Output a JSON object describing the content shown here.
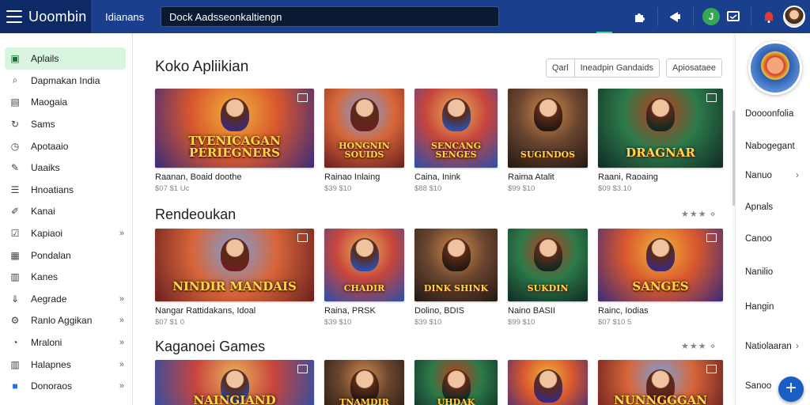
{
  "header": {
    "brand": "Uoombin",
    "label": "Idianans",
    "search_value": "Dock Aadsseonkaltiengn"
  },
  "sidebar": {
    "items": [
      {
        "label": "Aplails",
        "icon": "apps-icon",
        "active": true
      },
      {
        "label": "Dapmakan India",
        "icon": "search-icon"
      },
      {
        "label": "Maogaia",
        "icon": "briefcase-icon"
      },
      {
        "label": "Sams",
        "icon": "refresh-icon"
      },
      {
        "label": "Apotaaio",
        "icon": "clock-icon"
      },
      {
        "label": "Uaaiks",
        "icon": "pencil-icon"
      },
      {
        "label": "Hnoatians",
        "icon": "list-icon"
      },
      {
        "label": "Kanai",
        "icon": "edit-icon"
      },
      {
        "label": "Kapiaoi",
        "icon": "checkbox-icon",
        "chevron": "»"
      },
      {
        "label": "Pondalan",
        "icon": "grid-icon"
      },
      {
        "label": "Kanes",
        "icon": "table-icon"
      },
      {
        "label": "Aegrade",
        "icon": "download-icon",
        "chevron": "»"
      },
      {
        "label": "Ranlo Aggikan",
        "icon": "settings-icon",
        "chevron": "»"
      },
      {
        "label": "Mraloni",
        "icon": "gauge-icon",
        "chevron": "»"
      },
      {
        "label": "Halapnes",
        "icon": "table-icon",
        "chevron": "»"
      },
      {
        "label": "Donoraos",
        "icon": "blue-app-icon",
        "chevron": "»"
      }
    ]
  },
  "main": {
    "section1": {
      "title": "Koko Apliikian",
      "filters": [
        "Qarl",
        "Ineadpin Gandaids",
        "Apiosataee"
      ],
      "cards": [
        {
          "title": "Raanan, Boaid doothe",
          "price": "$07 $1 Uc",
          "art": "TVENICAGAN PERIEGNERS"
        },
        {
          "title": "Rainao Inlaing",
          "price": "$39 $10",
          "art": "HONGNIN SOUIDS"
        },
        {
          "title": "Caina, Inink",
          "price": "$88 $10",
          "art": "SENCANG SENGES"
        },
        {
          "title": "Raima Atalit",
          "price": "$99 $10",
          "art": "SUGINDOS"
        },
        {
          "title": "Raani, Raoaing",
          "price": "$09 $3.10",
          "art": "DRAGNAR"
        }
      ]
    },
    "section2": {
      "title": "Rendeoukan",
      "stars": "★★★ ⋄",
      "cards": [
        {
          "title": "Nangar Rattidakans, Idoal",
          "price": "$07 $1 0",
          "art": "NINDIR MANDAIS"
        },
        {
          "title": "Raina, PRSK",
          "price": "$39 $10",
          "art": "CHADIR"
        },
        {
          "title": "Dolino, BDIS",
          "price": "$39 $10",
          "art": "DINK SHINK"
        },
        {
          "title": "Naino BASII",
          "price": "$99 $10",
          "art": "SUKDIN"
        },
        {
          "title": "Rainc, Iodias",
          "price": "$07 $10 5",
          "art": "SANGES"
        }
      ]
    },
    "section3": {
      "title": "Kaganoei Games",
      "stars": "★★★ ⋄",
      "cards": [
        {
          "art": "NAINGIAND"
        },
        {
          "art": "TNAMDIR"
        },
        {
          "art": "UHDAK"
        },
        {
          "art": ""
        },
        {
          "art": "NUNNGGGAN"
        }
      ]
    }
  },
  "right_panel": {
    "items": [
      {
        "label": "Doooonfolia"
      },
      {
        "label": "Nabogegant"
      },
      {
        "label": "Nanuo",
        "chevron": "›"
      },
      {
        "label": "Apnals"
      },
      {
        "label": "Canoo"
      },
      {
        "label": "Nanilio"
      },
      {
        "label": "Hangin"
      },
      {
        "label": "Natiolaaran",
        "chevron": "›"
      },
      {
        "label": "Sanoo"
      }
    ],
    "fab_label": "+"
  },
  "colors": {
    "topbar": "#1a3f8c",
    "brand_bg": "#0d2a66",
    "active_nav": "#d7f5df",
    "fab": "#1a5dc4"
  }
}
